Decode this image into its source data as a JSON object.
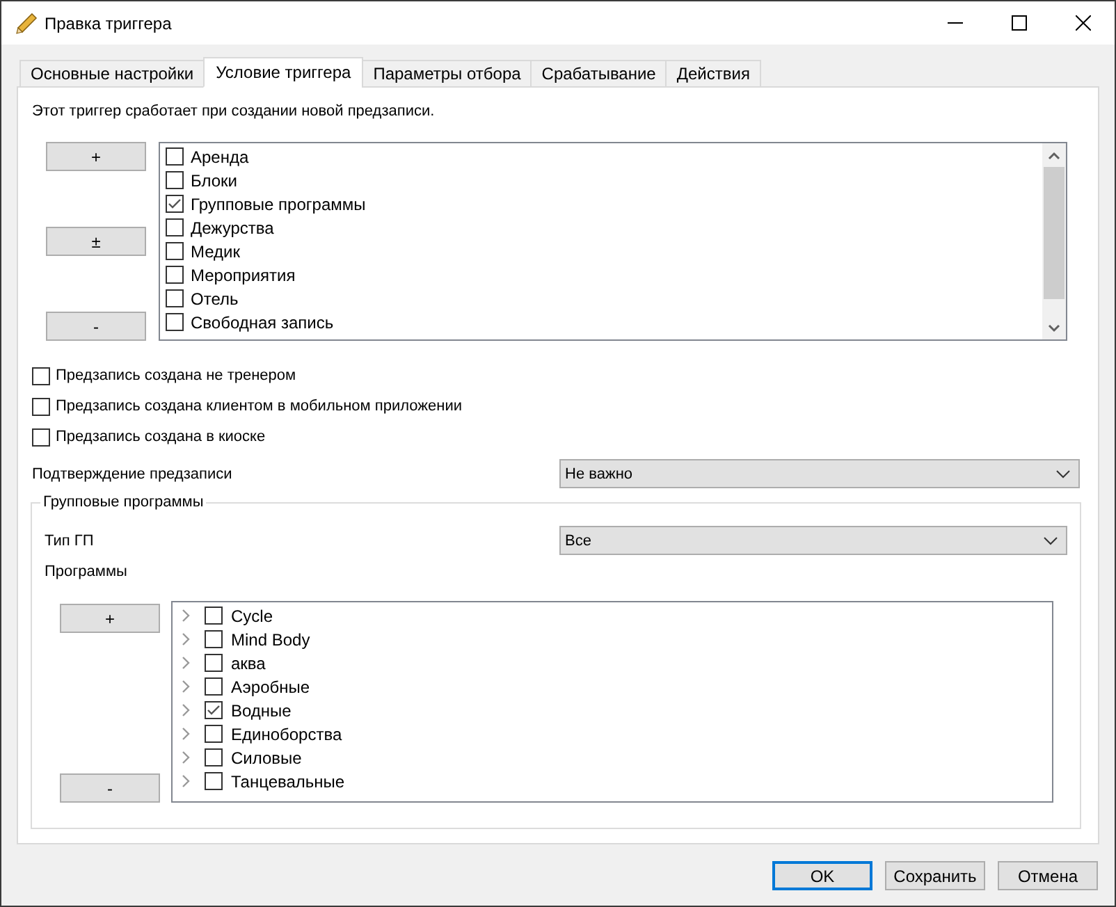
{
  "window": {
    "title": "Правка триггера"
  },
  "tabs": [
    {
      "label": "Основные настройки",
      "selected": false
    },
    {
      "label": "Условие триггера",
      "selected": true
    },
    {
      "label": "Параметры отбора",
      "selected": false
    },
    {
      "label": "Срабатывание",
      "selected": false
    },
    {
      "label": "Действия",
      "selected": false
    }
  ],
  "condition": {
    "description": "Этот триггер сработает при создании новой предзаписи.",
    "list_buttons": [
      "+",
      "±",
      "-"
    ],
    "categories": [
      {
        "label": "Аренда",
        "checked": false
      },
      {
        "label": "Блоки",
        "checked": false
      },
      {
        "label": "Групповые программы",
        "checked": true
      },
      {
        "label": "Дежурства",
        "checked": false
      },
      {
        "label": "Медик",
        "checked": false
      },
      {
        "label": "Мероприятия",
        "checked": false
      },
      {
        "label": "Отель",
        "checked": false
      },
      {
        "label": "Свободная запись",
        "checked": false
      }
    ],
    "options": [
      {
        "label": "Предзапись создана не тренером",
        "checked": false
      },
      {
        "label": "Предзапись создана клиентом в мобильном приложении",
        "checked": false
      },
      {
        "label": "Предзапись создана в киоске",
        "checked": false
      }
    ],
    "confirmation": {
      "label": "Подтверждение предзаписи",
      "value": "Не важно"
    },
    "group_programs": {
      "title": "Групповые программы",
      "type_label": "Тип ГП",
      "type_value": "Все",
      "programs_label": "Программы",
      "buttons": [
        "+",
        "-"
      ],
      "programs": [
        {
          "label": "Cycle",
          "checked": false,
          "expanded": false
        },
        {
          "label": "Mind Body",
          "checked": false,
          "expanded": false
        },
        {
          "label": "аква",
          "checked": false,
          "expanded": false
        },
        {
          "label": "Аэробные",
          "checked": false,
          "expanded": false
        },
        {
          "label": "Водные",
          "checked": true,
          "expanded": false
        },
        {
          "label": "Единоборства",
          "checked": false,
          "expanded": false
        },
        {
          "label": "Силовые",
          "checked": false,
          "expanded": false
        },
        {
          "label": "Танцевальные",
          "checked": false,
          "expanded": false
        }
      ]
    }
  },
  "buttons": [
    {
      "label": "OK",
      "default": true
    },
    {
      "label": "Сохранить",
      "default": false
    },
    {
      "label": "Отмена",
      "default": false
    }
  ]
}
